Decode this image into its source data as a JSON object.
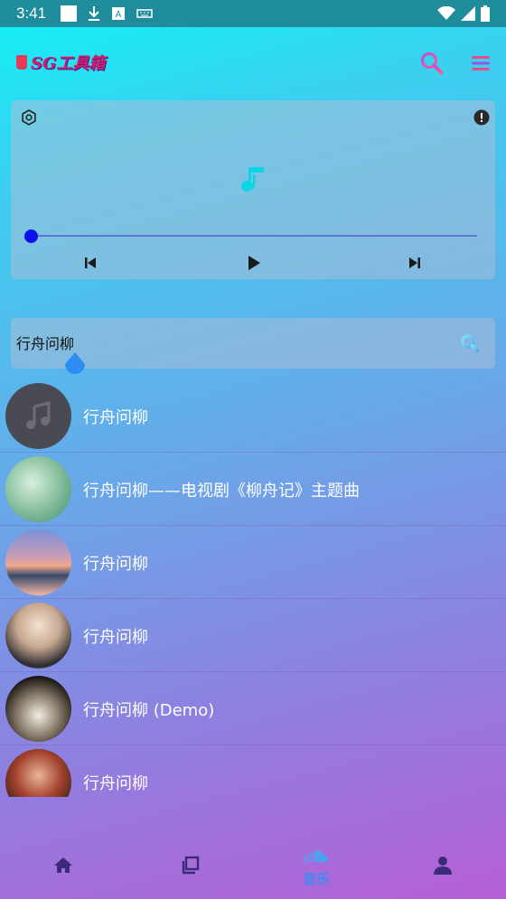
{
  "status_bar": {
    "time": "3:41",
    "icons_left": [
      "square-icon",
      "download-icon",
      "keyboard-a-icon",
      "keyboard-icon"
    ],
    "icons_right": [
      "wifi-icon",
      "cellular-icon",
      "battery-icon"
    ]
  },
  "header": {
    "brand_text": "SG工具箱",
    "icons": [
      "search-icon",
      "menu-icon"
    ]
  },
  "player": {
    "icons": [
      "settings-icon",
      "info-icon",
      "music-note-icon",
      "previous-icon",
      "play-icon",
      "next-icon"
    ],
    "progress": 0
  },
  "search": {
    "value": "行舟问柳",
    "icon": "search-icon"
  },
  "songs": [
    {
      "title": "行舟问柳"
    },
    {
      "title": "行舟问柳——电视剧《柳舟记》主题曲"
    },
    {
      "title": "行舟问柳"
    },
    {
      "title": "行舟问柳"
    },
    {
      "title": "行舟问柳 (Demo)"
    },
    {
      "title": "行舟问柳"
    }
  ],
  "bottom_nav": [
    {
      "icon": "home-icon",
      "label": ""
    },
    {
      "icon": "copy-icon",
      "label": ""
    },
    {
      "icon": "soundcloud-icon",
      "label": "音乐",
      "active": true
    },
    {
      "icon": "person-icon",
      "label": ""
    }
  ],
  "colors": {
    "accent": "#3b8ef0",
    "progress_thumb": "#0a12e8",
    "status_bar": "#1f8c9b"
  }
}
